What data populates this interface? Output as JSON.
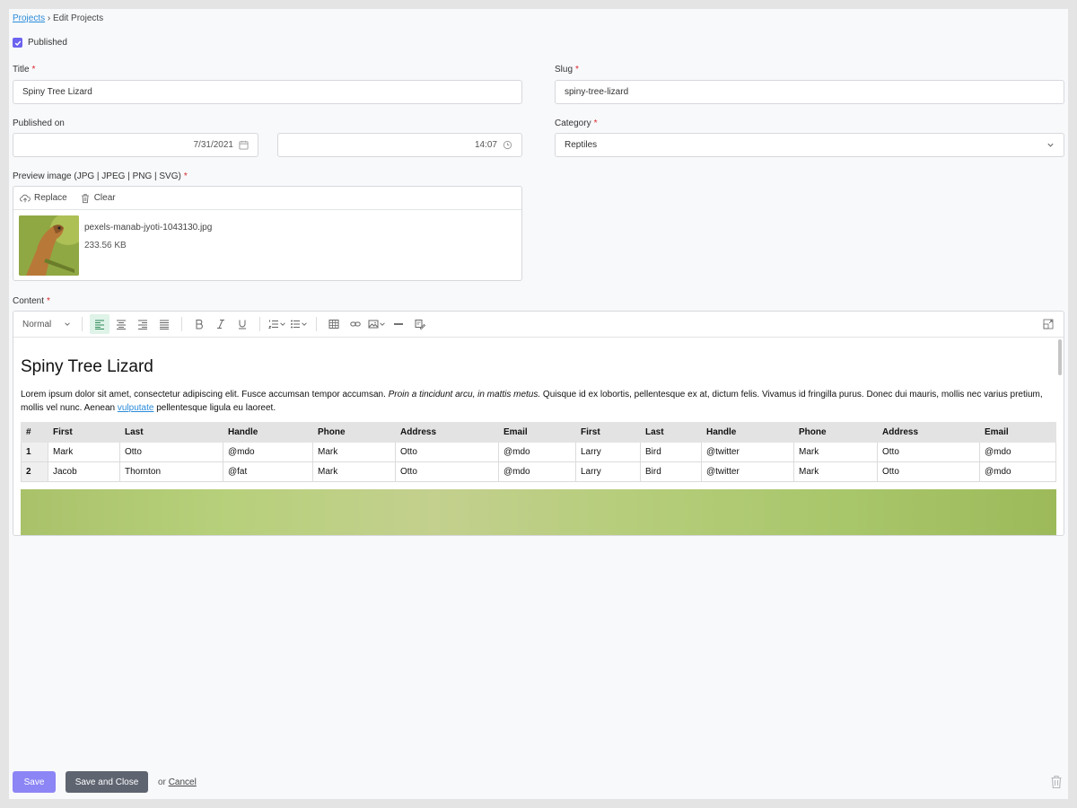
{
  "breadcrumb": {
    "root": "Projects",
    "sep": "›",
    "current": "Edit Projects"
  },
  "published": {
    "label": "Published",
    "checked": true
  },
  "title": {
    "label": "Title",
    "value": "Spiny Tree Lizard"
  },
  "slug": {
    "label": "Slug",
    "value": "spiny-tree-lizard"
  },
  "published_on": {
    "label": "Published on",
    "date": "7/31/2021",
    "time": "14:07"
  },
  "category": {
    "label": "Category",
    "value": "Reptiles"
  },
  "preview_image": {
    "label": "Preview image (JPG | JPEG | PNG | SVG)",
    "replace_label": "Replace",
    "clear_label": "Clear",
    "file_name": "pexels-manab-jyoti-1043130.jpg",
    "file_size": "233.56 KB"
  },
  "content": {
    "label": "Content",
    "format_label": "Normal",
    "heading": "Spiny Tree Lizard",
    "para_1": "Lorem ipsum dolor sit amet, consectetur adipiscing elit. Fusce accumsan tempor accumsan. ",
    "para_italic": "Proin a tincidunt arcu, in mattis metus.",
    "para_2": " Quisque id ex lobortis, pellentesque ex at, dictum felis. Vivamus id fringilla purus. Donec dui mauris, mollis nec varius pretium, mollis vel nunc. Aenean ",
    "para_link": "vulputate",
    "para_3": " pellentesque ligula eu laoreet.",
    "table": {
      "headers": [
        "#",
        "First",
        "Last",
        "Handle",
        "Phone",
        "Address",
        "Email",
        "First",
        "Last",
        "Handle",
        "Phone",
        "Address",
        "Email"
      ],
      "rows": [
        [
          "1",
          "Mark",
          "Otto",
          "@mdo",
          "Mark",
          "Otto",
          "@mdo",
          "Larry",
          "Bird",
          "@twitter",
          "Mark",
          "Otto",
          "@mdo"
        ],
        [
          "2",
          "Jacob",
          "Thornton",
          "@fat",
          "Mark",
          "Otto",
          "@mdo",
          "Larry",
          "Bird",
          "@twitter",
          "Mark",
          "Otto",
          "@mdo"
        ]
      ]
    }
  },
  "actions": {
    "save": "Save",
    "save_close": "Save and Close",
    "or": "or",
    "cancel": "Cancel"
  },
  "colors": {
    "accent": "#6c63f0",
    "required": "#d9262a",
    "link": "#2a8bd9"
  }
}
